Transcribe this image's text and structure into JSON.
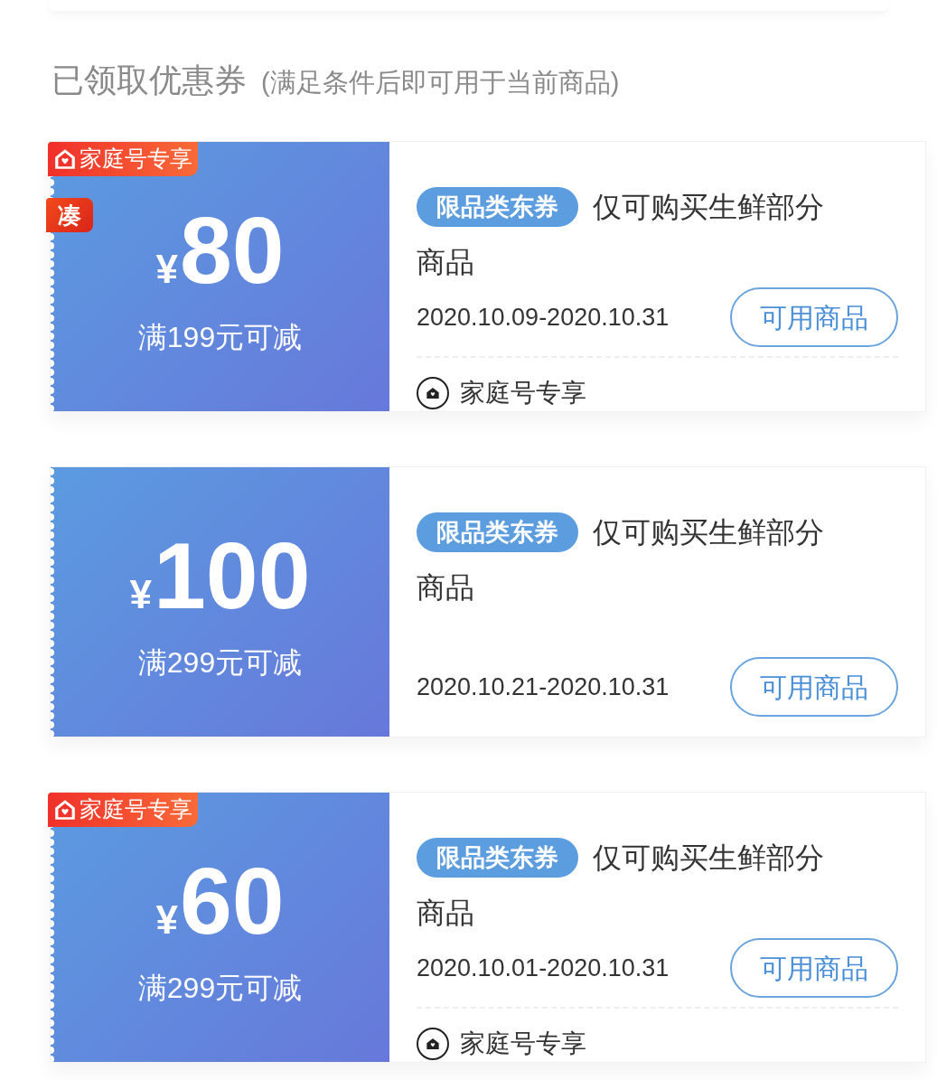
{
  "heading": {
    "title": "已领取优惠券",
    "note": "(满足条件后即可用于当前商品)"
  },
  "coupons": [
    {
      "family_badge": "家庭号专享",
      "stack_badge": "凑",
      "currency": "¥",
      "amount": "80",
      "condition": "满199元可减",
      "tag": "限品类东券",
      "description": "仅可购买生鲜部分商品",
      "validity": "2020.10.09-2020.10.31",
      "button": "可用商品",
      "footer": "家庭号专享"
    },
    {
      "currency": "¥",
      "amount": "100",
      "condition": "满299元可减",
      "tag": "限品类东券",
      "description": "仅可购买生鲜部分商品",
      "validity": "2020.10.21-2020.10.31",
      "button": "可用商品"
    },
    {
      "family_badge": "家庭号专享",
      "currency": "¥",
      "amount": "60",
      "condition": "满299元可减",
      "tag": "限品类东券",
      "description": "仅可购买生鲜部分商品",
      "validity": "2020.10.01-2020.10.31",
      "button": "可用商品",
      "footer": "家庭号专享"
    }
  ]
}
